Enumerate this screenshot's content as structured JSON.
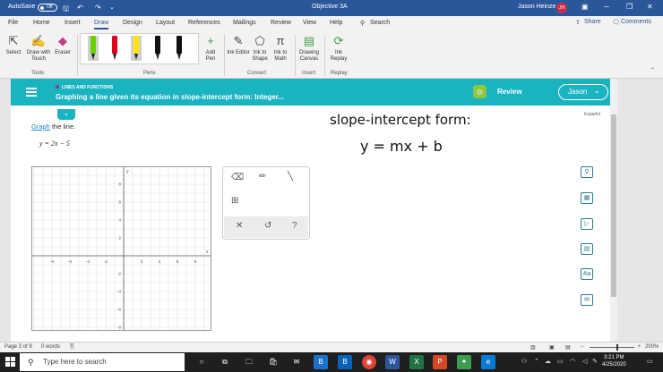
{
  "titlebar": {
    "autosave_label": "AutoSave",
    "autosave_state": "Off",
    "doc_title": "Objective 3A",
    "user_name": "Jason Heinze",
    "user_initials": "JH"
  },
  "tabs": [
    "File",
    "Home",
    "Insert",
    "Draw",
    "Design",
    "Layout",
    "References",
    "Mailings",
    "Review",
    "View",
    "Help"
  ],
  "active_tab": "Draw",
  "search_label": "Search",
  "share_label": "Share",
  "comments_label": "Comments",
  "ribbon": {
    "select": "Select",
    "draw_with_touch": "Draw with Touch",
    "eraser": "Eraser",
    "add_pen": "Add Pen",
    "ink_editor": "Ink Editor",
    "ink_to_shape": "Ink to Shape",
    "ink_to_math": "Ink to Math",
    "drawing_canvas": "Drawing Canvas",
    "ink_replay": "Ink Replay",
    "groups": {
      "tools": "Tools",
      "pens": "Pens",
      "convert": "Convert",
      "insert": "Insert",
      "replay": "Replay"
    }
  },
  "pens": [
    {
      "color": "#6bd000"
    },
    {
      "color": "#e1001a"
    },
    {
      "color": "#ffe600"
    },
    {
      "color": "#111111"
    },
    {
      "color": "#111111"
    },
    {
      "color": "#111111"
    }
  ],
  "aleks": {
    "topic": "LINES AND FUNCTIONS",
    "problem_title": "Graphing a line given its equation in slope-intercept form: Integer...",
    "review_label": "Review",
    "user_button": "Jason",
    "instruction_link": "Graph",
    "instruction_rest": " the line.",
    "equation": "y = 2x − 5",
    "espanol": "Español",
    "brand_color": "#1ab3c0"
  },
  "handwriting": {
    "line1": "slope-intercept form:",
    "line2": "y = mx + b"
  },
  "graph": {
    "x_ticks": [
      "-8",
      "-6",
      "-4",
      "-2",
      "2",
      "4",
      "6",
      "8"
    ],
    "y_ticks": [
      "8",
      "6",
      "4",
      "2",
      "-2",
      "-4",
      "-6",
      "-8"
    ],
    "x_axis_label": "x",
    "y_axis_label": "y"
  },
  "palette_tools": [
    "eraser-icon",
    "pencil-icon",
    "line-icon",
    "grid-icon",
    "close-icon",
    "undo-icon",
    "help-icon"
  ],
  "status": {
    "page": "Page 3 of 9",
    "words": "0 words",
    "zoom": "200%"
  },
  "taskbar": {
    "search_placeholder": "Type here to search",
    "time": "3:21 PM",
    "date": "4/25/2020"
  }
}
